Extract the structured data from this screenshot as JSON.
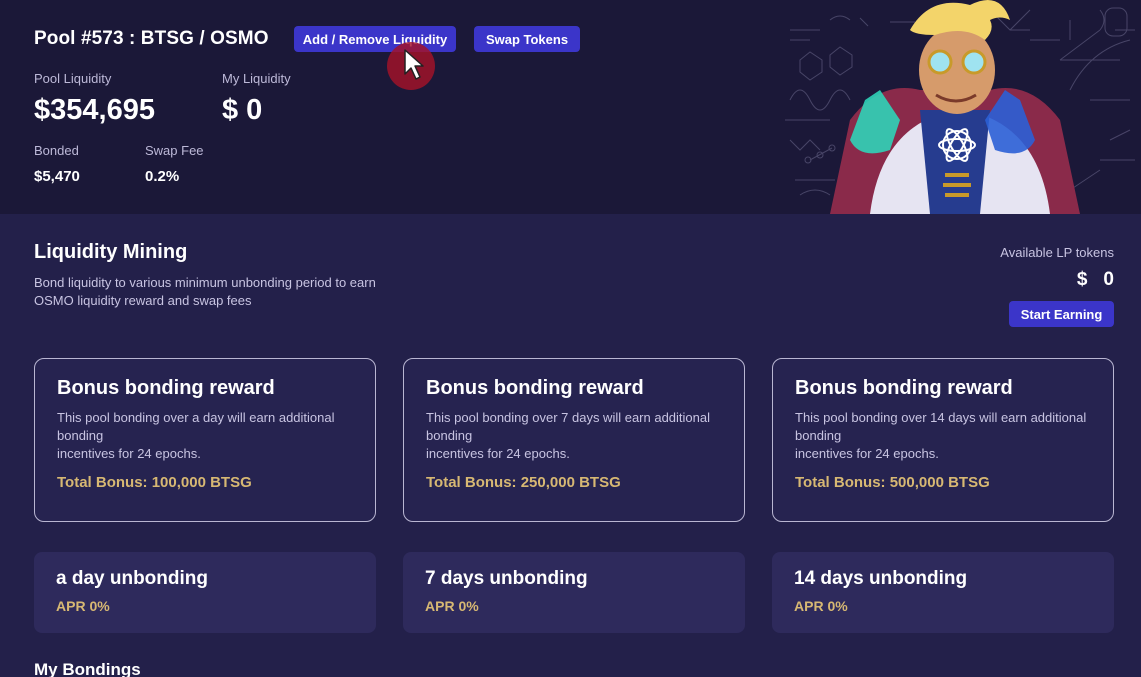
{
  "header": {
    "pool_title": "Pool #573 : BTSG / OSMO",
    "add_remove_label": "Add / Remove Liquidity",
    "swap_label": "Swap Tokens",
    "pool_liquidity_label": "Pool Liquidity",
    "pool_liquidity_value": "$354,695",
    "my_liquidity_label": "My Liquidity",
    "my_liquidity_value": "$ 0",
    "bonded_label": "Bonded",
    "bonded_value": "$5,470",
    "swap_fee_label": "Swap Fee",
    "swap_fee_value": "0.2%"
  },
  "mining": {
    "title": "Liquidity Mining",
    "description_line1": "Bond liquidity to various minimum unbonding period to earn",
    "description_line2": "OSMO liquidity reward and swap fees",
    "available_lp_label": "Available LP tokens",
    "available_lp_currency": "$",
    "available_lp_value": "0",
    "start_earning_label": "Start Earning"
  },
  "bonus_cards": [
    {
      "title": "Bonus bonding reward",
      "desc_line1": "This pool bonding over a day will earn additional bonding",
      "desc_line2": "incentives for 24 epochs.",
      "total": "Total Bonus: 100,000 BTSG"
    },
    {
      "title": "Bonus bonding reward",
      "desc_line1": "This pool bonding over 7 days will earn additional bonding",
      "desc_line2": "incentives for 24 epochs.",
      "total": "Total Bonus: 250,000 BTSG"
    },
    {
      "title": "Bonus bonding reward",
      "desc_line1": "This pool bonding over 14 days will earn additional bonding",
      "desc_line2": "incentives for 24 epochs.",
      "total": "Total Bonus: 500,000 BTSG"
    }
  ],
  "unbonding_cards": [
    {
      "title": "a day unbonding",
      "apr": "APR 0%"
    },
    {
      "title": "7 days unbonding",
      "apr": "APR 0%"
    },
    {
      "title": "14 days unbonding",
      "apr": "APR 0%"
    }
  ],
  "my_bondings_title": "My Bondings",
  "colors": {
    "background": "#23204a",
    "header_background": "#1b1838",
    "button": "#3b35c9",
    "accent_gold": "#d7b873",
    "cursor_halo": "#a51228"
  },
  "icons": {
    "cursor": "mouse-pointer-icon",
    "hero": "wizard-scientist-illustration"
  }
}
